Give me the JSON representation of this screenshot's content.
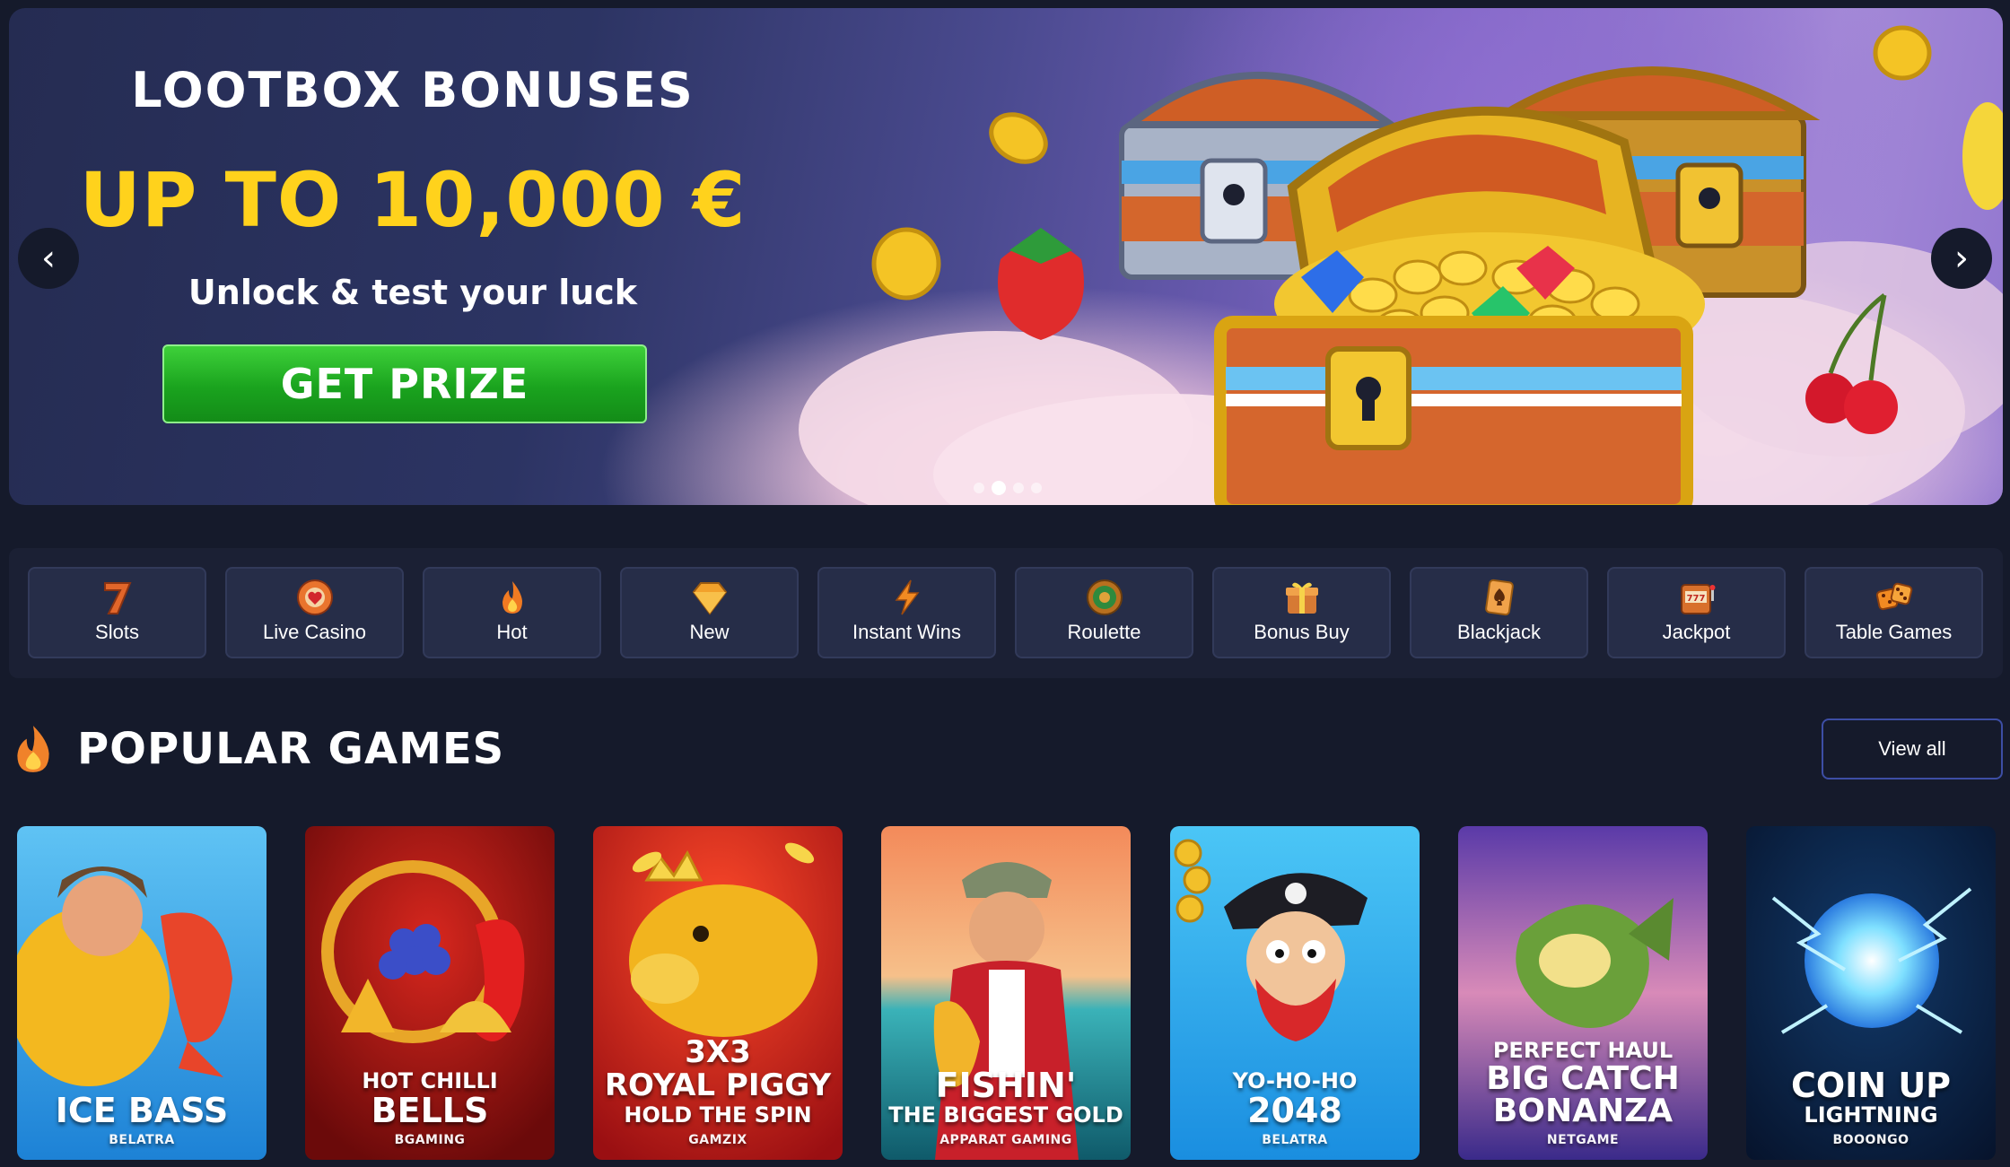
{
  "hero": {
    "title": "LOOTBOX BONUSES",
    "amount": "UP TO 10,000 €",
    "subtitle": "Unlock & test your luck",
    "cta_label": "GET PRIZE",
    "prev_glyph": "‹",
    "next_glyph": "›",
    "slides_total": 4,
    "active_slide": 2
  },
  "categories": [
    {
      "label": "Slots",
      "icon": "seven-icon"
    },
    {
      "label": "Live Casino",
      "icon": "roulette-chip-icon"
    },
    {
      "label": "Hot",
      "icon": "flame-icon"
    },
    {
      "label": "New",
      "icon": "diamond-icon"
    },
    {
      "label": "Instant Wins",
      "icon": "lightning-icon"
    },
    {
      "label": "Roulette",
      "icon": "roulette-wheel-icon"
    },
    {
      "label": "Bonus Buy",
      "icon": "gift-box-icon"
    },
    {
      "label": "Blackjack",
      "icon": "playing-card-icon"
    },
    {
      "label": "Jackpot",
      "icon": "slot-machine-icon"
    },
    {
      "label": "Table Games",
      "icon": "dice-icon"
    }
  ],
  "popular": {
    "title": "POPULAR GAMES",
    "view_all": "View all",
    "games": [
      {
        "pre": "",
        "name": "ICE BASS",
        "post": "",
        "provider": "BELATRA"
      },
      {
        "pre": "HOT CHILLI",
        "name": "BELLS",
        "post": "",
        "provider": "BGAMING"
      },
      {
        "pre": "3X3",
        "name": "ROYAL PIGGY",
        "post": "HOLD THE SPIN",
        "provider": "GAMZIX"
      },
      {
        "pre": "",
        "name": "FISHIN'",
        "post": "THE BIGGEST GOLD",
        "provider": "APPARAT GAMING"
      },
      {
        "pre": "YO-HO-HO",
        "name": "2048",
        "post": "",
        "provider": "BELATRA"
      },
      {
        "pre": "PERFECT HAUL",
        "name": "BIG CATCH BONANZA",
        "post": "",
        "provider": "NETGAME"
      },
      {
        "pre": "",
        "name": "COIN UP",
        "post": "LIGHTNING",
        "provider": "BOOONGO"
      }
    ]
  },
  "colors": {
    "page_bg": "#151a2b",
    "accent_yellow": "#ffd21c",
    "cta_green": "#1aa31e",
    "category_bg": "#262d48",
    "view_all_border": "#3d4ea5"
  }
}
